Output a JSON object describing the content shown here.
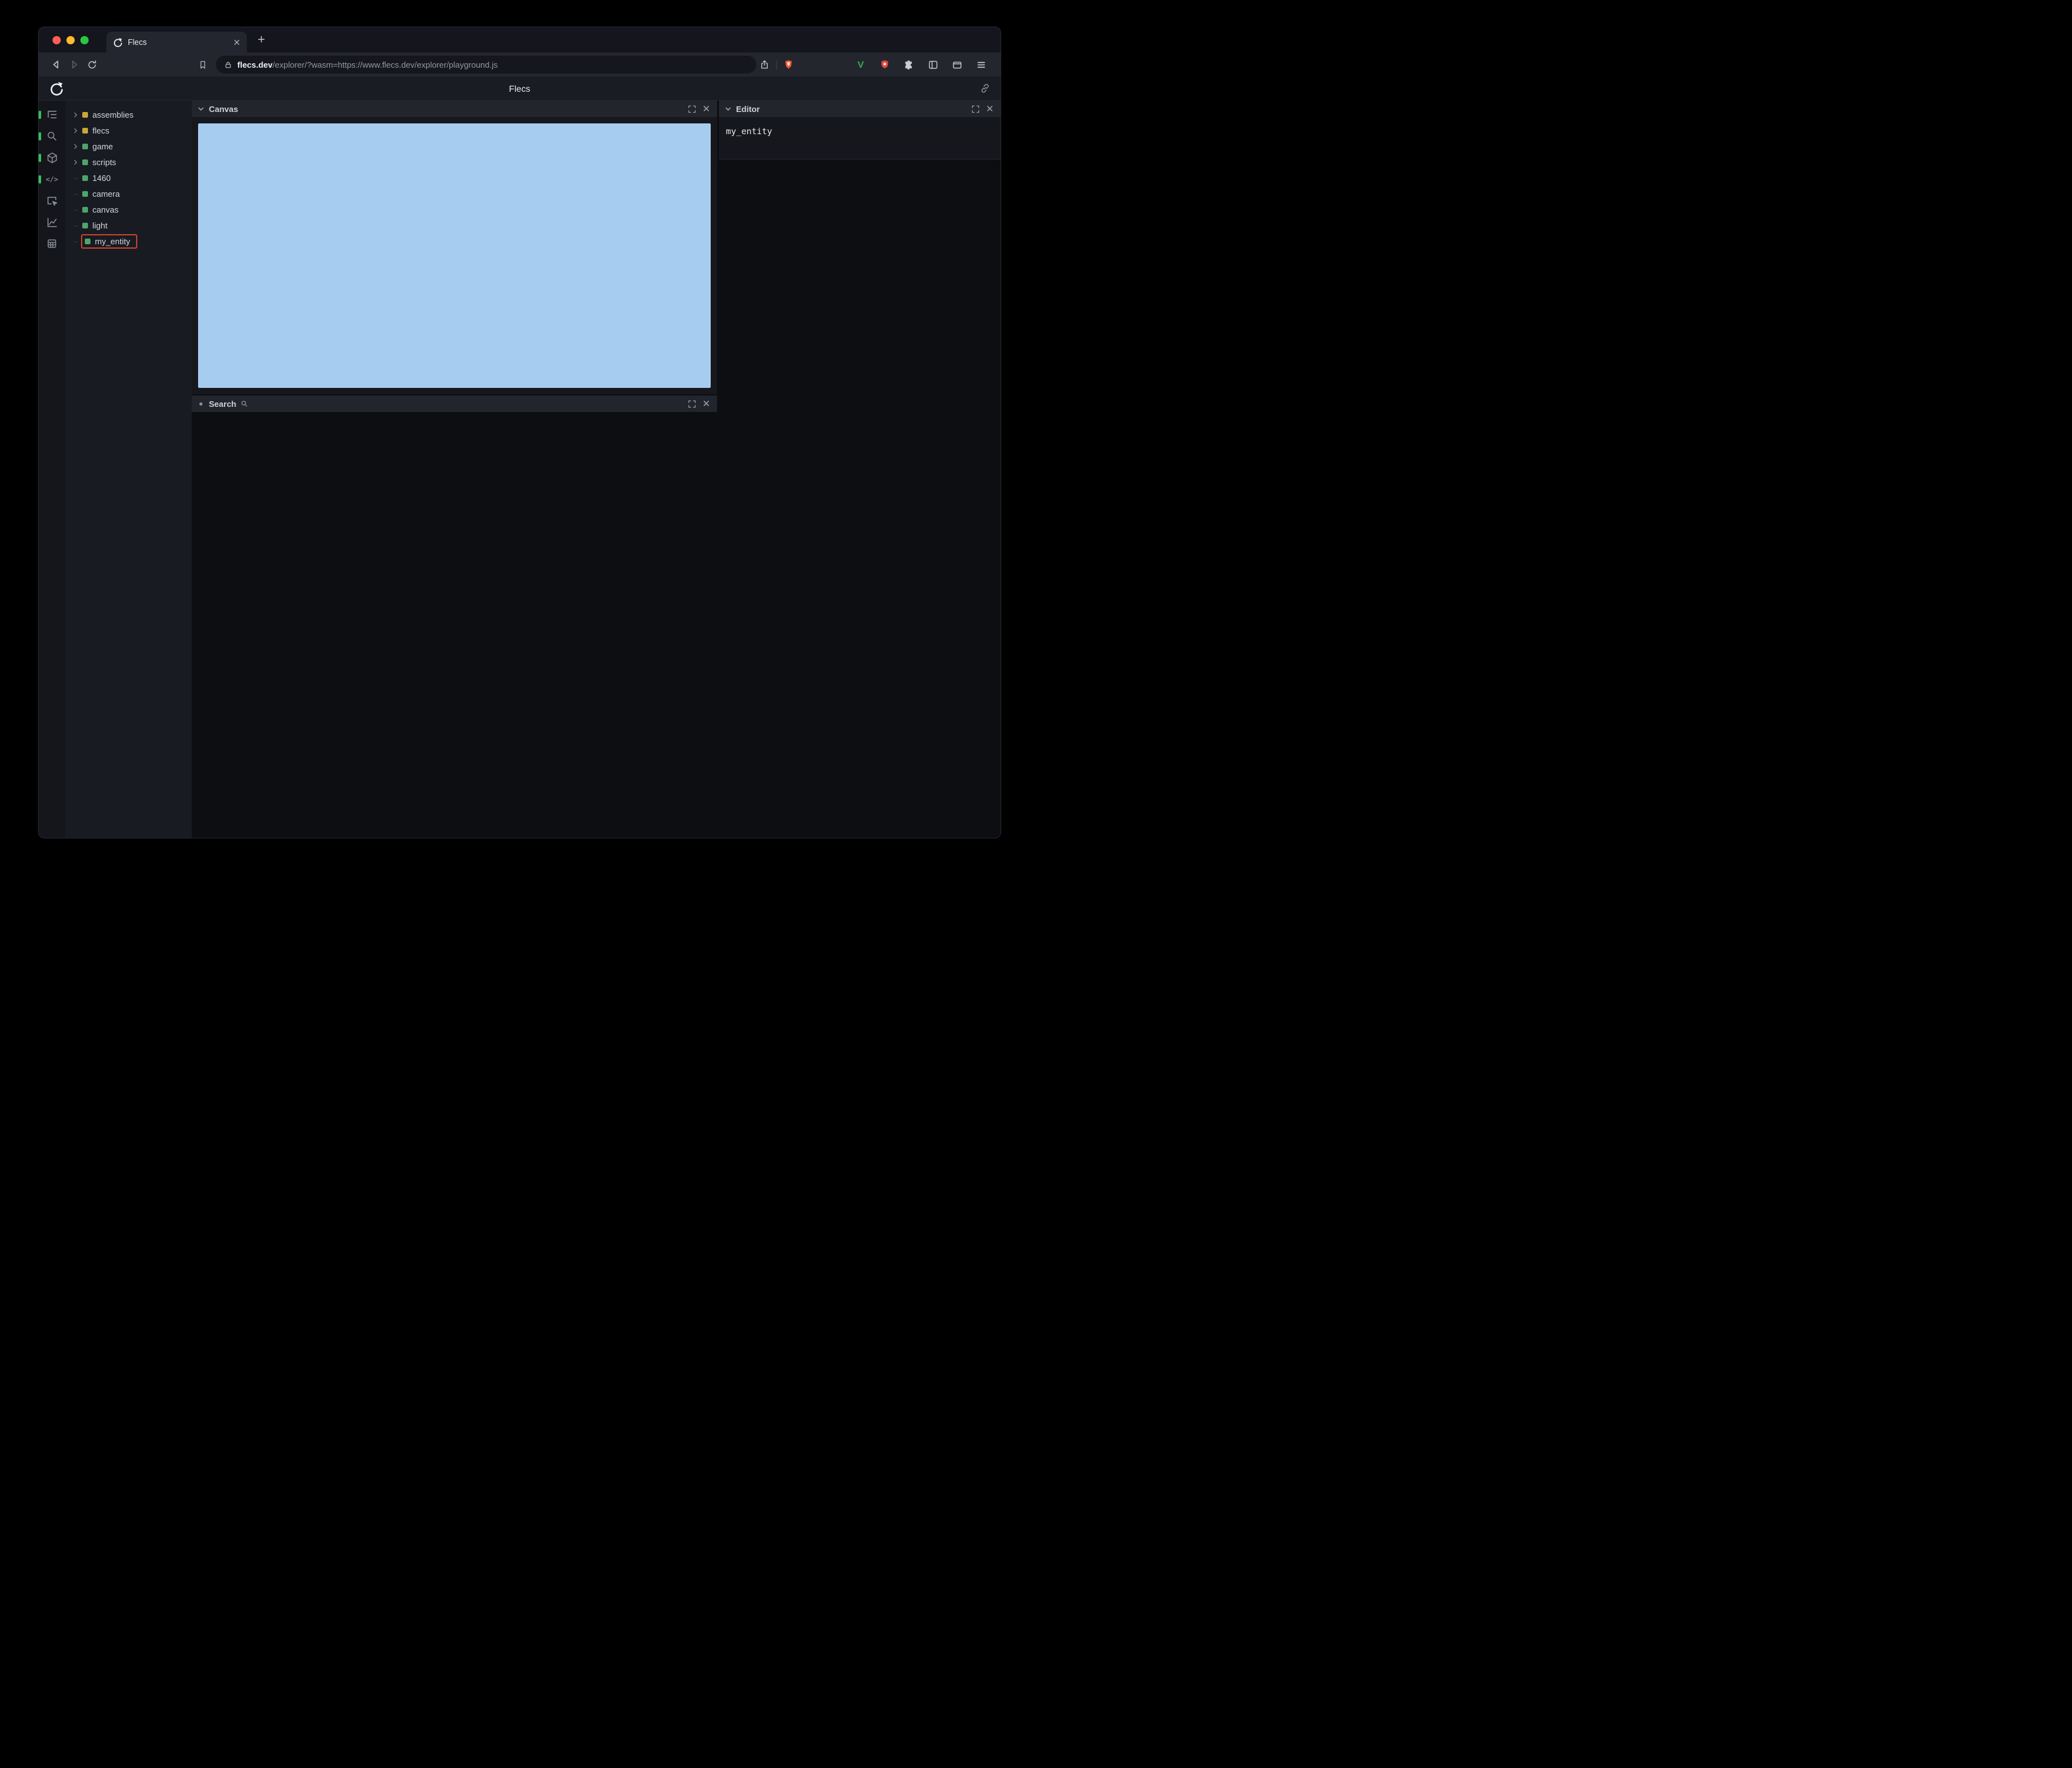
{
  "browser": {
    "tab": {
      "title": "Flecs"
    },
    "new_tab_label": "+",
    "url": {
      "domain": "flecs.dev",
      "path": "/explorer/?wasm=https://www.flecs.dev/explorer/playground.js"
    }
  },
  "app": {
    "header": {
      "title": "Flecs"
    },
    "rail": {
      "icons": [
        "hierarchy-icon",
        "search-icon",
        "cube-icon",
        "code-icon",
        "inspect-icon",
        "chart-icon",
        "rows-icon"
      ]
    },
    "tree": {
      "items": [
        {
          "label": "assemblies",
          "kind": "module",
          "expandable": true
        },
        {
          "label": "flecs",
          "kind": "module",
          "expandable": true
        },
        {
          "label": "game",
          "kind": "entity",
          "expandable": true
        },
        {
          "label": "scripts",
          "kind": "entity",
          "expandable": true
        },
        {
          "label": "1460",
          "kind": "entity",
          "expandable": false
        },
        {
          "label": "camera",
          "kind": "entity",
          "expandable": false
        },
        {
          "label": "canvas",
          "kind": "entity",
          "expandable": false
        },
        {
          "label": "light",
          "kind": "entity",
          "expandable": false
        },
        {
          "label": "my_entity",
          "kind": "entity",
          "expandable": false,
          "highlighted": true
        }
      ]
    },
    "panels": {
      "canvas": {
        "title": "Canvas"
      },
      "search": {
        "title": "Search"
      },
      "editor": {
        "title": "Editor",
        "content": "my_entity"
      }
    },
    "colors": {
      "canvas_blue": "#a6cdf0",
      "module_square": "#c9a53a",
      "entity_square": "#4ea46c",
      "highlight_outline": "#c4432f",
      "active_indicator": "#35c05c"
    }
  }
}
